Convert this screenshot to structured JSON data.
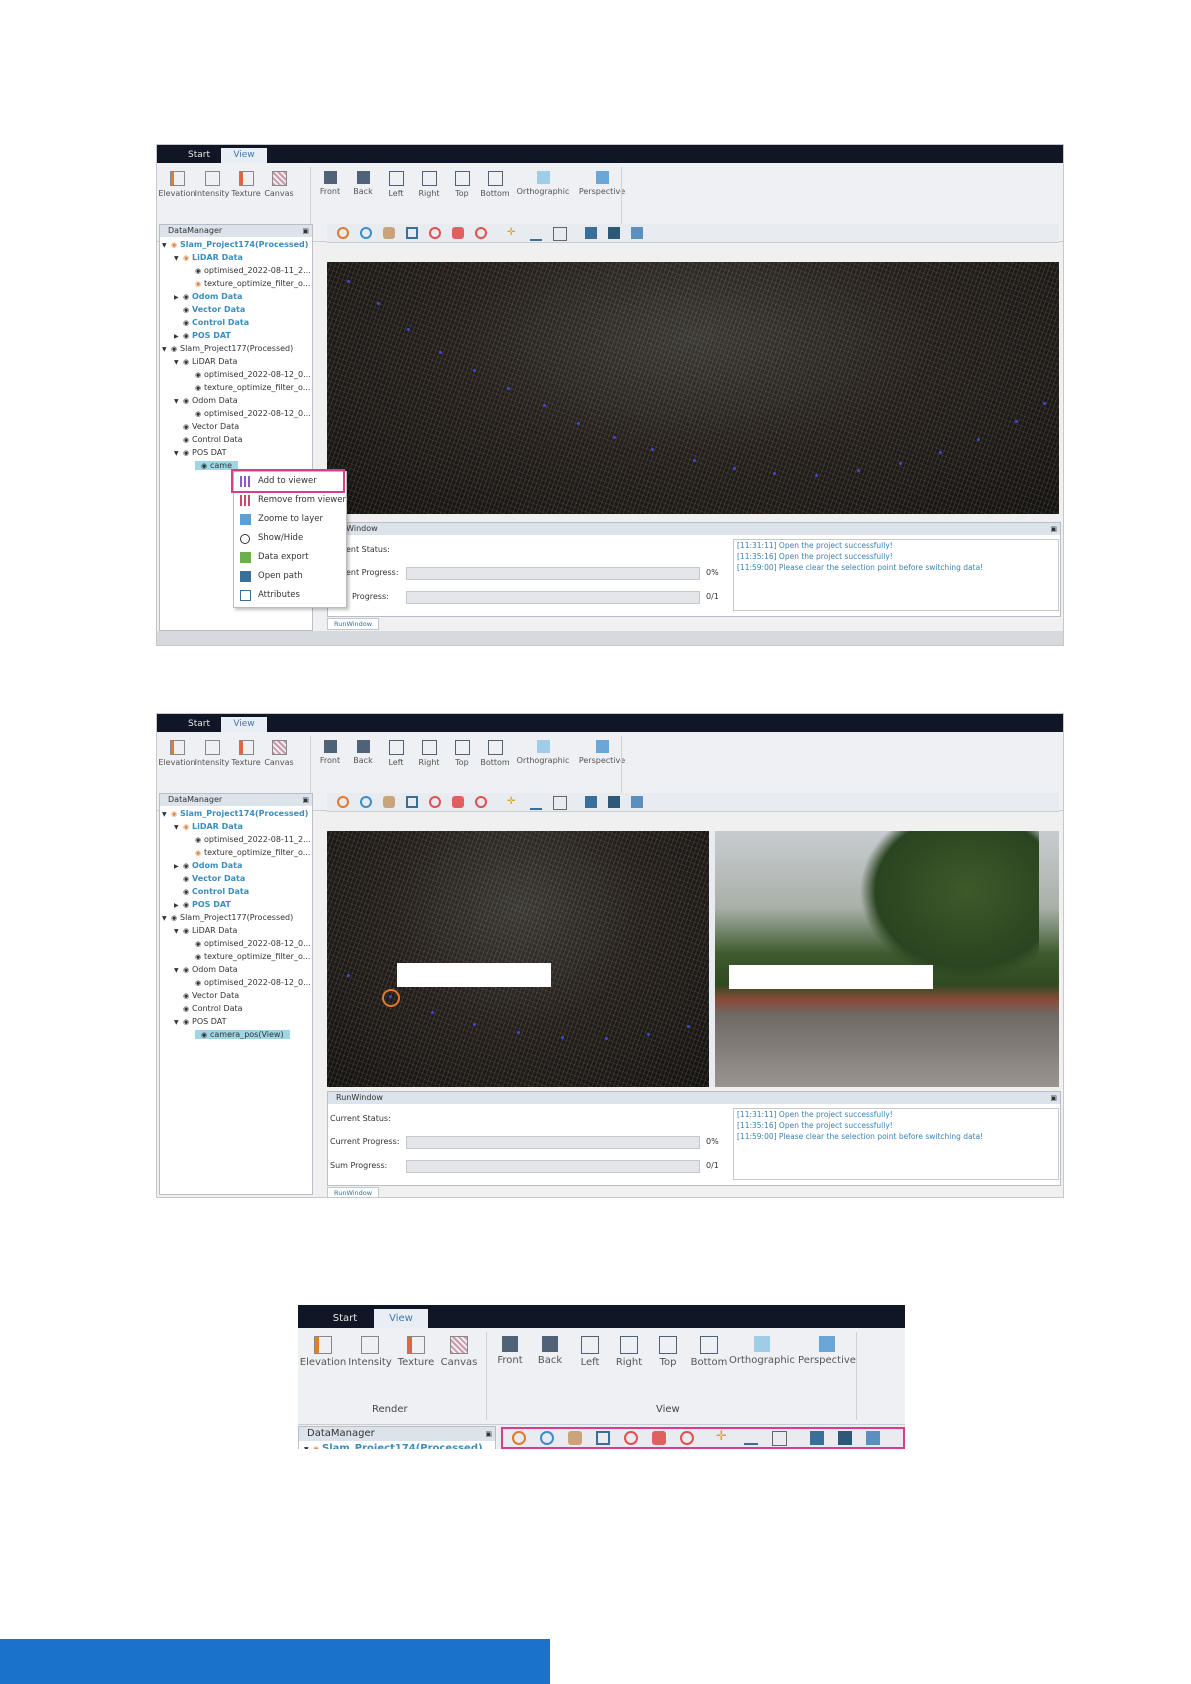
{
  "ribbon": {
    "tabs": [
      {
        "label": "Start"
      },
      {
        "label": "View"
      }
    ],
    "render_buttons": [
      {
        "label": "Elevation",
        "icon": "elevation-icon"
      },
      {
        "label": "Intensity",
        "icon": "intensity-icon"
      },
      {
        "label": "Texture",
        "icon": "texture-icon"
      },
      {
        "label": "Canvas",
        "icon": "canvas-icon"
      }
    ],
    "view_buttons": [
      {
        "label": "Front",
        "icon": "cube-front-icon"
      },
      {
        "label": "Back",
        "icon": "cube-back-icon"
      },
      {
        "label": "Left",
        "icon": "cube-left-icon"
      },
      {
        "label": "Right",
        "icon": "cube-right-icon"
      },
      {
        "label": "Top",
        "icon": "cube-top-icon"
      },
      {
        "label": "Bottom",
        "icon": "cube-bottom-icon"
      },
      {
        "label": "Orthographic",
        "icon": "orthographic-icon"
      },
      {
        "label": "Perspective",
        "icon": "perspective-icon"
      }
    ],
    "group_render": "Render",
    "group_view": "View"
  },
  "datamanager": {
    "title": "DataManager",
    "tree": [
      {
        "label": "Slam_Project174(Processed)",
        "hl": true
      },
      {
        "label": "LiDAR Data",
        "hl": true
      },
      {
        "label": "optimised_2022-08-11_2..."
      },
      {
        "label": "texture_optimize_filter_o..."
      },
      {
        "label": "Odom Data",
        "hl": true
      },
      {
        "label": "Vector Data",
        "hl": true
      },
      {
        "label": "Control Data",
        "hl": true
      },
      {
        "label": "POS DAT",
        "hl": true
      },
      {
        "label": "Slam_Project177(Processed)"
      },
      {
        "label": "LiDAR Data"
      },
      {
        "label": "optimised_2022-08-12_0..."
      },
      {
        "label": "texture_optimize_filter_o..."
      },
      {
        "label": "Odom Data"
      },
      {
        "label": "optimised_2022-08-12_0..."
      },
      {
        "label": "Vector Data"
      },
      {
        "label": "Control Data"
      },
      {
        "label": "POS DAT"
      }
    ],
    "camera_node_short": "came",
    "camera_node_full": "camera_pos(View)"
  },
  "context_menu": [
    {
      "label": "Add to viewer",
      "icon": "add-viewer-icon"
    },
    {
      "label": "Remove from viewer",
      "icon": "remove-viewer-icon"
    },
    {
      "label": "Zoome to layer",
      "icon": "zoom-layer-icon"
    },
    {
      "label": "Show/Hide",
      "icon": "eye-icon"
    },
    {
      "label": "Data export",
      "icon": "export-icon"
    },
    {
      "label": "Open path",
      "icon": "folder-icon"
    },
    {
      "label": "Attributes",
      "icon": "attributes-icon"
    }
  ],
  "runwindow": {
    "title": "RunWindow",
    "title_cut": "unWindow",
    "current_status": "Current Status:",
    "current_status_cut": "ent Status:",
    "current_progress": "Current Progress:",
    "current_progress_cut": "ent Progress:",
    "sum_progress": "Sum Progress:",
    "sum_progress_cut": "Progress:",
    "current_value": "0%",
    "sum_value": "0/1",
    "log": [
      "[11:31:11] Open the project successfully!",
      "[11:35:16] Open the project successfully!",
      "[11:59:00] Please clear the selection point before switching data!"
    ],
    "tab": "RunWindow"
  },
  "colors": {
    "accent": "#3b8dbd",
    "highlight": "#d83c8c",
    "titlebar": "#101626",
    "footer": "#1a73c8"
  }
}
